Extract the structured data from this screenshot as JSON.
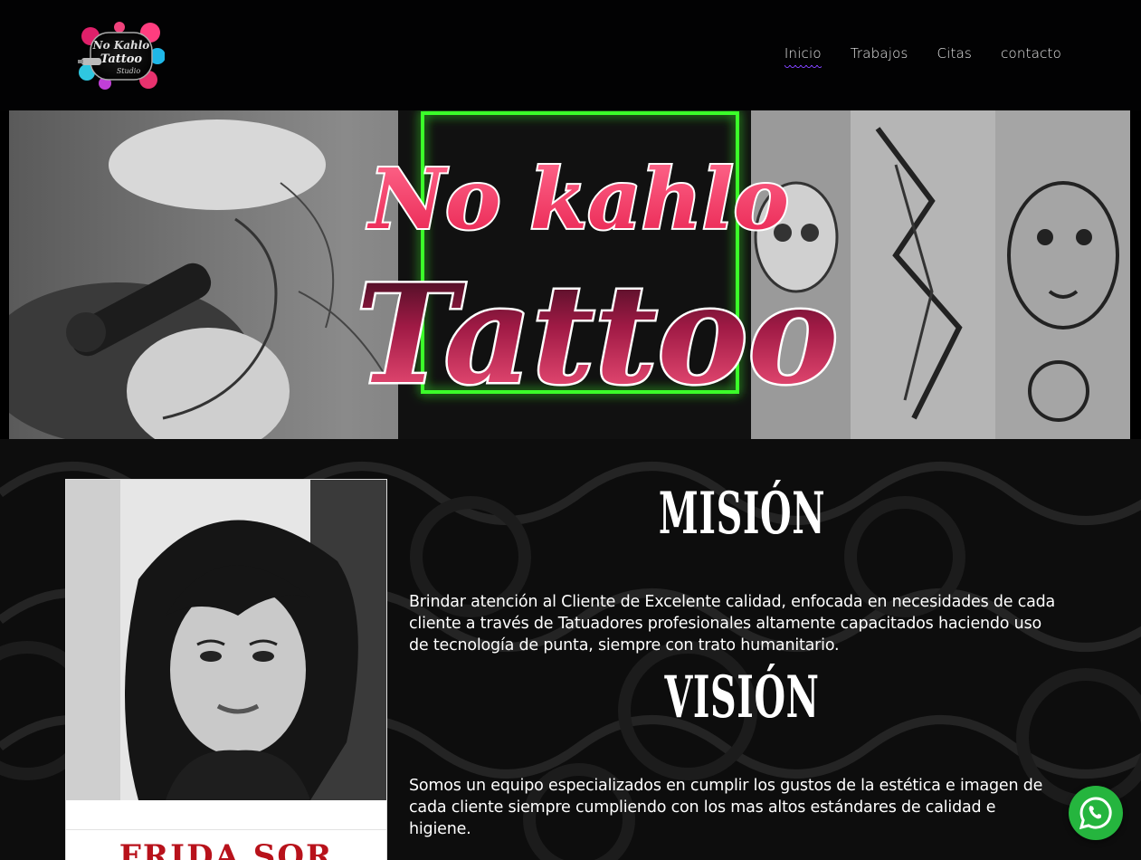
{
  "brand": {
    "logo_lines": [
      "No Kahlo",
      "Tattoo",
      "Studio"
    ]
  },
  "nav": {
    "items": [
      {
        "label": "Inicio",
        "active": true
      },
      {
        "label": "Trabajos",
        "active": false
      },
      {
        "label": "Citas",
        "active": false
      },
      {
        "label": "contacto",
        "active": false
      }
    ],
    "accent_color": "#7b3ff2"
  },
  "hero": {
    "line1": "No kahlo",
    "line2": "Tattoo",
    "glow_color": "#3bff2a",
    "text_color": "#ff4f7a"
  },
  "profile": {
    "name": "FRIDA SOR"
  },
  "mision": {
    "title": "MISIÓN",
    "text": "Brindar atención al Cliente de Excelente calidad, enfocada en necesidades de cada cliente a través de Tatuadores profesionales altamente capacitados haciendo uso de tecnología de punta, siempre con trato humanitario."
  },
  "vision": {
    "title": "VISIÓN",
    "text": "Somos un equipo especializados en cumplir los gustos de la estética e imagen de cada cliente siempre cumpliendo con los mas altos estándares de calidad e higiene."
  },
  "whatsapp": {
    "icon": "whatsapp-icon",
    "color": "#25b53e"
  }
}
